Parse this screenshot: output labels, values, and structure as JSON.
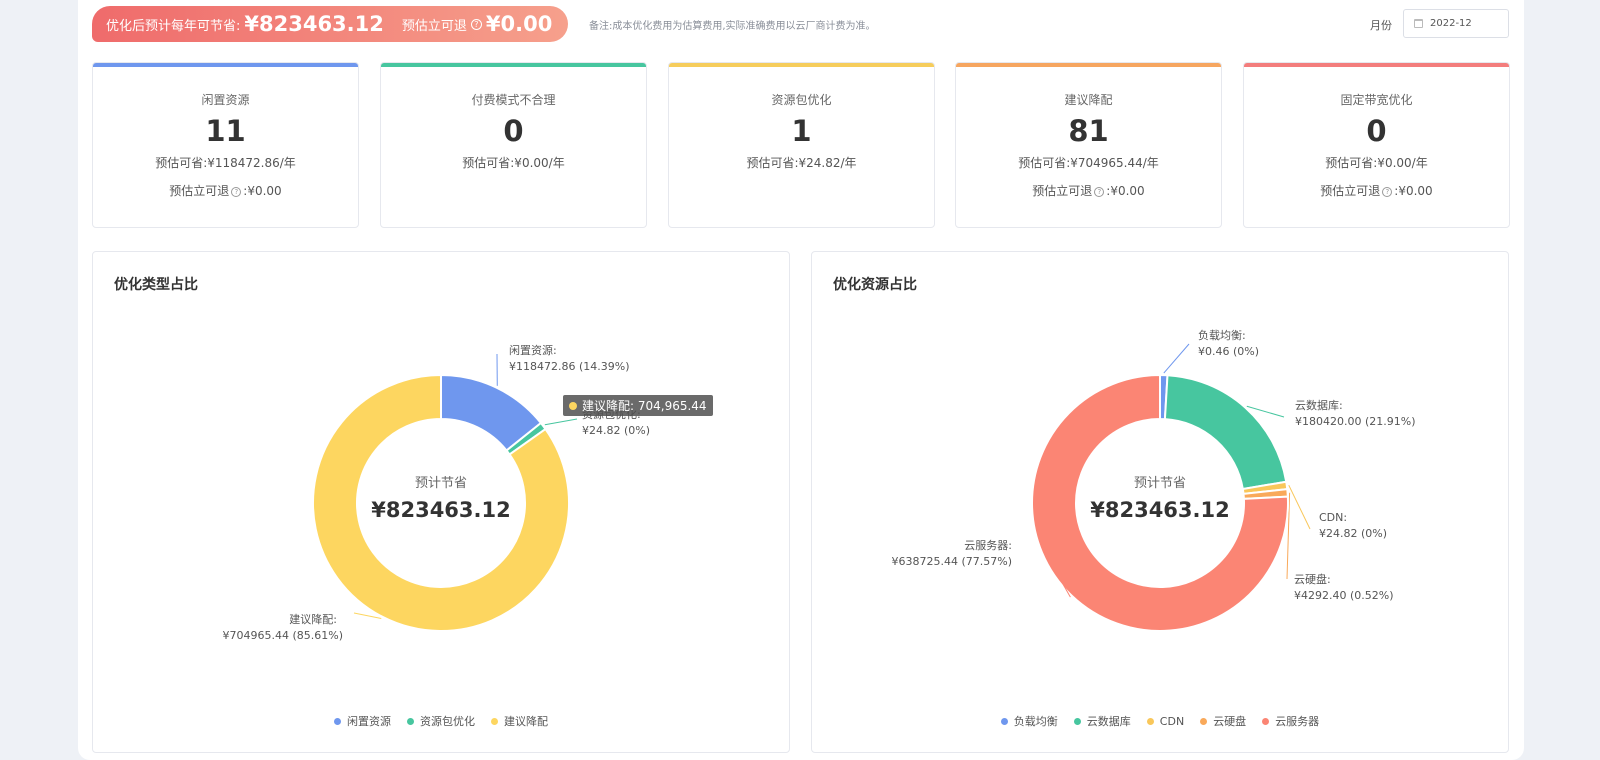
{
  "banner": {
    "label": "优化后预计每年可节省:",
    "value": "¥823463.12",
    "refund_label": "预估立可退",
    "refund_value": "¥0.00"
  },
  "note": "备注:成本优化费用为估算费用,实际准确费用以云厂商计费为准。",
  "month": {
    "label": "月份",
    "value": "2022-12"
  },
  "cards": [
    {
      "title": "闲置资源",
      "count": "11",
      "saving": "预估可省:¥118472.86/年",
      "refund": "预估立可退",
      "refund_value": ":¥0.00",
      "color": "#6f97ee"
    },
    {
      "title": "付费模式不合理",
      "count": "0",
      "saving": "预估可省:¥0.00/年",
      "refund": "",
      "refund_value": "",
      "color": "#47c69f"
    },
    {
      "title": "资源包优化",
      "count": "1",
      "saving": "预估可省:¥24.82/年",
      "refund": "",
      "refund_value": "",
      "color": "#f6cd5c"
    },
    {
      "title": "建议降配",
      "count": "81",
      "saving": "预估可省:¥704965.44/年",
      "refund": "预估立可退",
      "refund_value": ":¥0.00",
      "color": "#f6a660"
    },
    {
      "title": "固定带宽优化",
      "count": "0",
      "saving": "预估可省:¥0.00/年",
      "refund": "预估立可退",
      "refund_value": ":¥0.00",
      "color": "#f37d7d"
    }
  ],
  "panels": [
    {
      "title": "优化类型占比",
      "center_label": "预计节省",
      "center_value": "¥823463.12"
    },
    {
      "title": "优化资源占比",
      "center_label": "预计节省",
      "center_value": "¥823463.12"
    }
  ],
  "tooltip": {
    "text": "建议降配: 704,965.44"
  },
  "chart_data": [
    {
      "type": "pie",
      "title": "优化类型占比",
      "legend_position": "bottom",
      "slices": [
        {
          "name": "闲置资源",
          "value": 118472.86,
          "percent": "14.39%",
          "label": "闲置资源:",
          "value_label": "¥118472.86  (14.39%)",
          "color": "#6f97ee"
        },
        {
          "name": "资源包优化",
          "value": 24.82,
          "percent": "0%",
          "label": "资源包优化:",
          "value_label": "¥24.82  (0%)",
          "color": "#47c69f"
        },
        {
          "name": "建议降配",
          "value": 704965.44,
          "percent": "85.61%",
          "label": "建议降配:",
          "value_label": "¥704965.44  (85.61%)",
          "color": "#fdd660"
        }
      ]
    },
    {
      "type": "pie",
      "title": "优化资源占比",
      "legend_position": "bottom",
      "slices": [
        {
          "name": "负载均衡",
          "value": 0.46,
          "percent": "0%",
          "label": "负载均衡:",
          "value_label": "¥0.46  (0%)",
          "color": "#6f97ee"
        },
        {
          "name": "云数据库",
          "value": 180420.0,
          "percent": "21.91%",
          "label": "云数据库:",
          "value_label": "¥180420.00  (21.91%)",
          "color": "#47c69f"
        },
        {
          "name": "CDN",
          "value": 24.82,
          "percent": "0%",
          "label": "CDN:",
          "value_label": "¥24.82  (0%)",
          "color": "#f9c75a"
        },
        {
          "name": "云硬盘",
          "value": 4292.4,
          "percent": "0.52%",
          "label": "云硬盘:",
          "value_label": "¥4292.40  (0.52%)",
          "color": "#f9a95a"
        },
        {
          "name": "云服务器",
          "value": 638725.44,
          "percent": "77.57%",
          "label": "云服务器:",
          "value_label": "¥638725.44  (77.57%)",
          "color": "#fb8574"
        }
      ]
    }
  ]
}
